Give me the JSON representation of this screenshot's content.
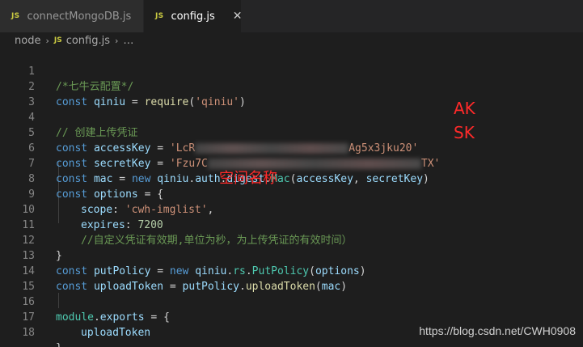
{
  "tabs": [
    {
      "badge": "JS",
      "label": "connectMongoDB.js"
    },
    {
      "badge": "JS",
      "label": "config.js",
      "close": "✕"
    }
  ],
  "breadcrumb": {
    "folder": "node",
    "sep": "›",
    "badge": "JS",
    "file": "config.js",
    "ellipsis": "…"
  },
  "code": {
    "line_numbers": [
      "1",
      "2",
      "3",
      "4",
      "5",
      "6",
      "7",
      "8",
      "9",
      "10",
      "11",
      "12",
      "13",
      "14",
      "15",
      "16",
      "17",
      "18"
    ],
    "l1": {
      "comment": "/*七牛云配置*/"
    },
    "l2": {
      "kw": "const",
      "var": "qiniu",
      "eq": " = ",
      "fn": "require",
      "p1": "(",
      "str": "'qiniu'",
      "p2": ")"
    },
    "l4": {
      "comment": "// 创建上传凭证"
    },
    "l5": {
      "kw": "const",
      "var": "accessKey",
      "eq": " = ",
      "str_start": "'LcR",
      "str_end": "Ag5x3jku20'"
    },
    "l6": {
      "kw": "const",
      "var": "secretKey",
      "eq": " = ",
      "str_start": "'Fzu7C",
      "str_end": "TX'"
    },
    "l7": {
      "kw": "const",
      "var": "mac",
      "eq": " = ",
      "new": "new",
      "obj": "qiniu",
      "d1": ".",
      "p_auth": "auth",
      "d2": ".",
      "p_digest": "digest",
      "d3": ".",
      "cls": "Mac",
      "open": "(",
      "a1": "accessKey",
      "comma": ", ",
      "a2": "secretKey",
      "close": ")"
    },
    "l8": {
      "kw": "const",
      "var": "options",
      "eq": " = {"
    },
    "l9": {
      "prop": "scope",
      "colon": ": ",
      "str": "'cwh-imglist'",
      "comma": ","
    },
    "l10": {
      "prop": "expires",
      "colon": ": ",
      "num": "7200"
    },
    "l11": {
      "comment": "//自定义凭证有效期,单位为秒，为上传凭证的有效时间）"
    },
    "l12": {
      "text": "}"
    },
    "l13": {
      "kw": "const",
      "var": "putPolicy",
      "eq": " = ",
      "new": "new",
      "obj": "qiniu",
      "d1": ".",
      "p_rs": "rs",
      "d2": ".",
      "cls": "PutPolicy",
      "open": "(",
      "arg": "options",
      "close": ")"
    },
    "l14": {
      "kw": "const",
      "var": "uploadToken",
      "eq": " = ",
      "obj": "putPolicy",
      "d1": ".",
      "fn": "uploadToken",
      "open": "(",
      "arg": "mac",
      "close": ")"
    },
    "l16": {
      "obj": "module",
      "d1": ".",
      "prop": "exports",
      "eq": " = {"
    },
    "l17": {
      "var": "uploadToken"
    },
    "l18": {
      "text": "}"
    }
  },
  "annotations": {
    "ak": "AK",
    "sk": "SK",
    "scope_note": "空间名称"
  },
  "watermark": "https://blog.csdn.net/CWH0908",
  "colors": {
    "keyword": "#569cd6",
    "variable": "#9cdcfe",
    "function": "#dcdcaa",
    "string": "#ce9178",
    "comment": "#6a9955",
    "number": "#b5cea8",
    "class": "#4ec9b0",
    "annotation": "#ff2a2a",
    "js_badge": "#cbcb41"
  }
}
